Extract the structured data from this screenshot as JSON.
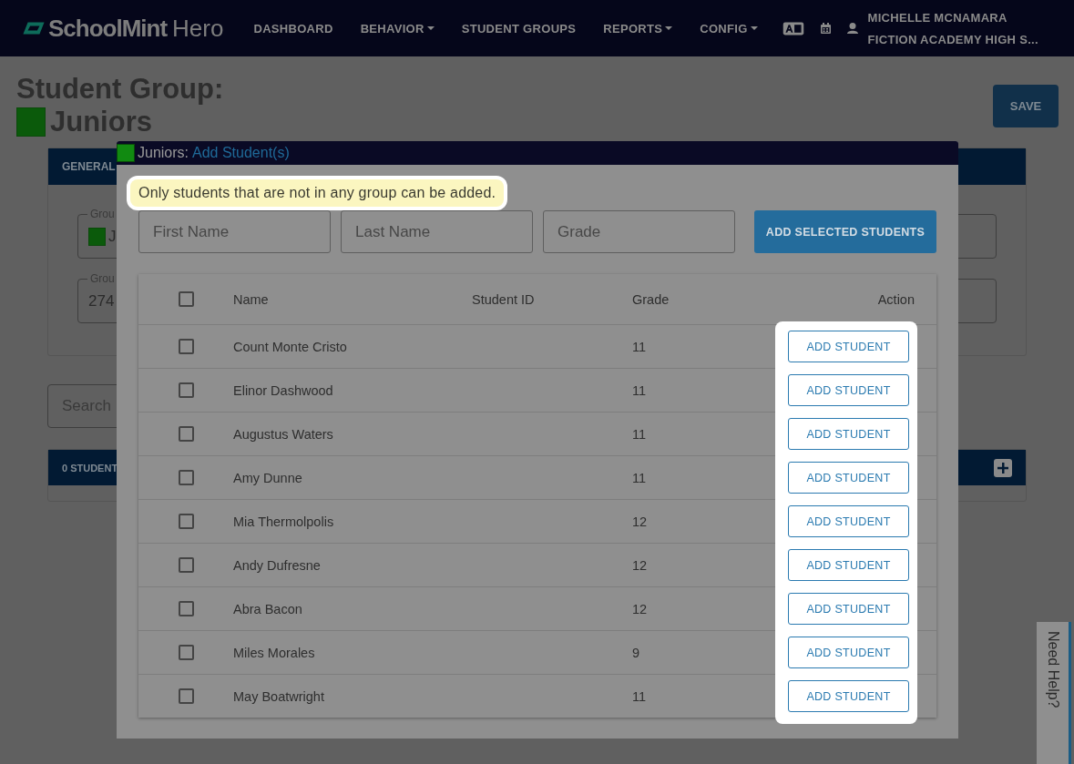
{
  "navbar": {
    "brand": "SchoolMint",
    "product": "Hero",
    "items": [
      {
        "label": "DASHBOARD",
        "dropdown": false
      },
      {
        "label": "BEHAVIOR",
        "dropdown": true
      },
      {
        "label": "STUDENT GROUPS",
        "dropdown": false
      },
      {
        "label": "REPORTS",
        "dropdown": true
      },
      {
        "label": "CONFIG",
        "dropdown": true
      }
    ],
    "user": {
      "name": "MICHELLE MCNAMARA",
      "school": "FICTION ACADEMY HIGH S..."
    }
  },
  "page": {
    "title": "Student Group:",
    "group_name": "Juniors",
    "save_button": "SAVE",
    "general_card": {
      "header": "GENERAL",
      "fields": [
        {
          "label": "Grou",
          "value": "J",
          "swatch": true
        },
        {
          "label": "Grou",
          "value": "274",
          "swatch": false
        }
      ]
    },
    "search": {
      "placeholder": "Search"
    },
    "students_card": {
      "header": "0 STUDENT"
    }
  },
  "modal": {
    "title": "Juniors:",
    "subtitle": "Add Student(s)",
    "note": {
      "text": "Only students that are not in any group can be added.",
      "highlighted": true
    },
    "filters": [
      {
        "placeholder": "First Name"
      },
      {
        "placeholder": "Last Name"
      },
      {
        "placeholder": "Grade"
      }
    ],
    "add_selected_button": "ADD SELECTED STUDENTS",
    "table": {
      "columns": [
        "Name",
        "Student ID",
        "Grade",
        "Action"
      ],
      "all_checked": false,
      "action_highlighted": true,
      "rows": [
        {
          "name": "Count Monte Cristo",
          "grade": "11",
          "checked": false,
          "action": "ADD STUDENT"
        },
        {
          "name": "Elinor Dashwood",
          "grade": "11",
          "checked": false,
          "action": "ADD STUDENT"
        },
        {
          "name": "Augustus Waters",
          "grade": "11",
          "checked": false,
          "action": "ADD STUDENT"
        },
        {
          "name": "Amy Dunne",
          "grade": "11",
          "checked": false,
          "action": "ADD STUDENT"
        },
        {
          "name": "Mia Thermolpolis",
          "grade": "12",
          "checked": false,
          "action": "ADD STUDENT"
        },
        {
          "name": "Andy Dufresne",
          "grade": "12",
          "checked": false,
          "action": "ADD STUDENT"
        },
        {
          "name": "Abra Bacon",
          "grade": "12",
          "checked": false,
          "action": "ADD STUDENT"
        },
        {
          "name": "Miles Morales",
          "grade": "9",
          "checked": false,
          "action": "ADD STUDENT"
        },
        {
          "name": "May Boatwright",
          "grade": "11",
          "checked": false,
          "action": "ADD STUDENT"
        }
      ]
    }
  },
  "help_tab": "Need Help?"
}
